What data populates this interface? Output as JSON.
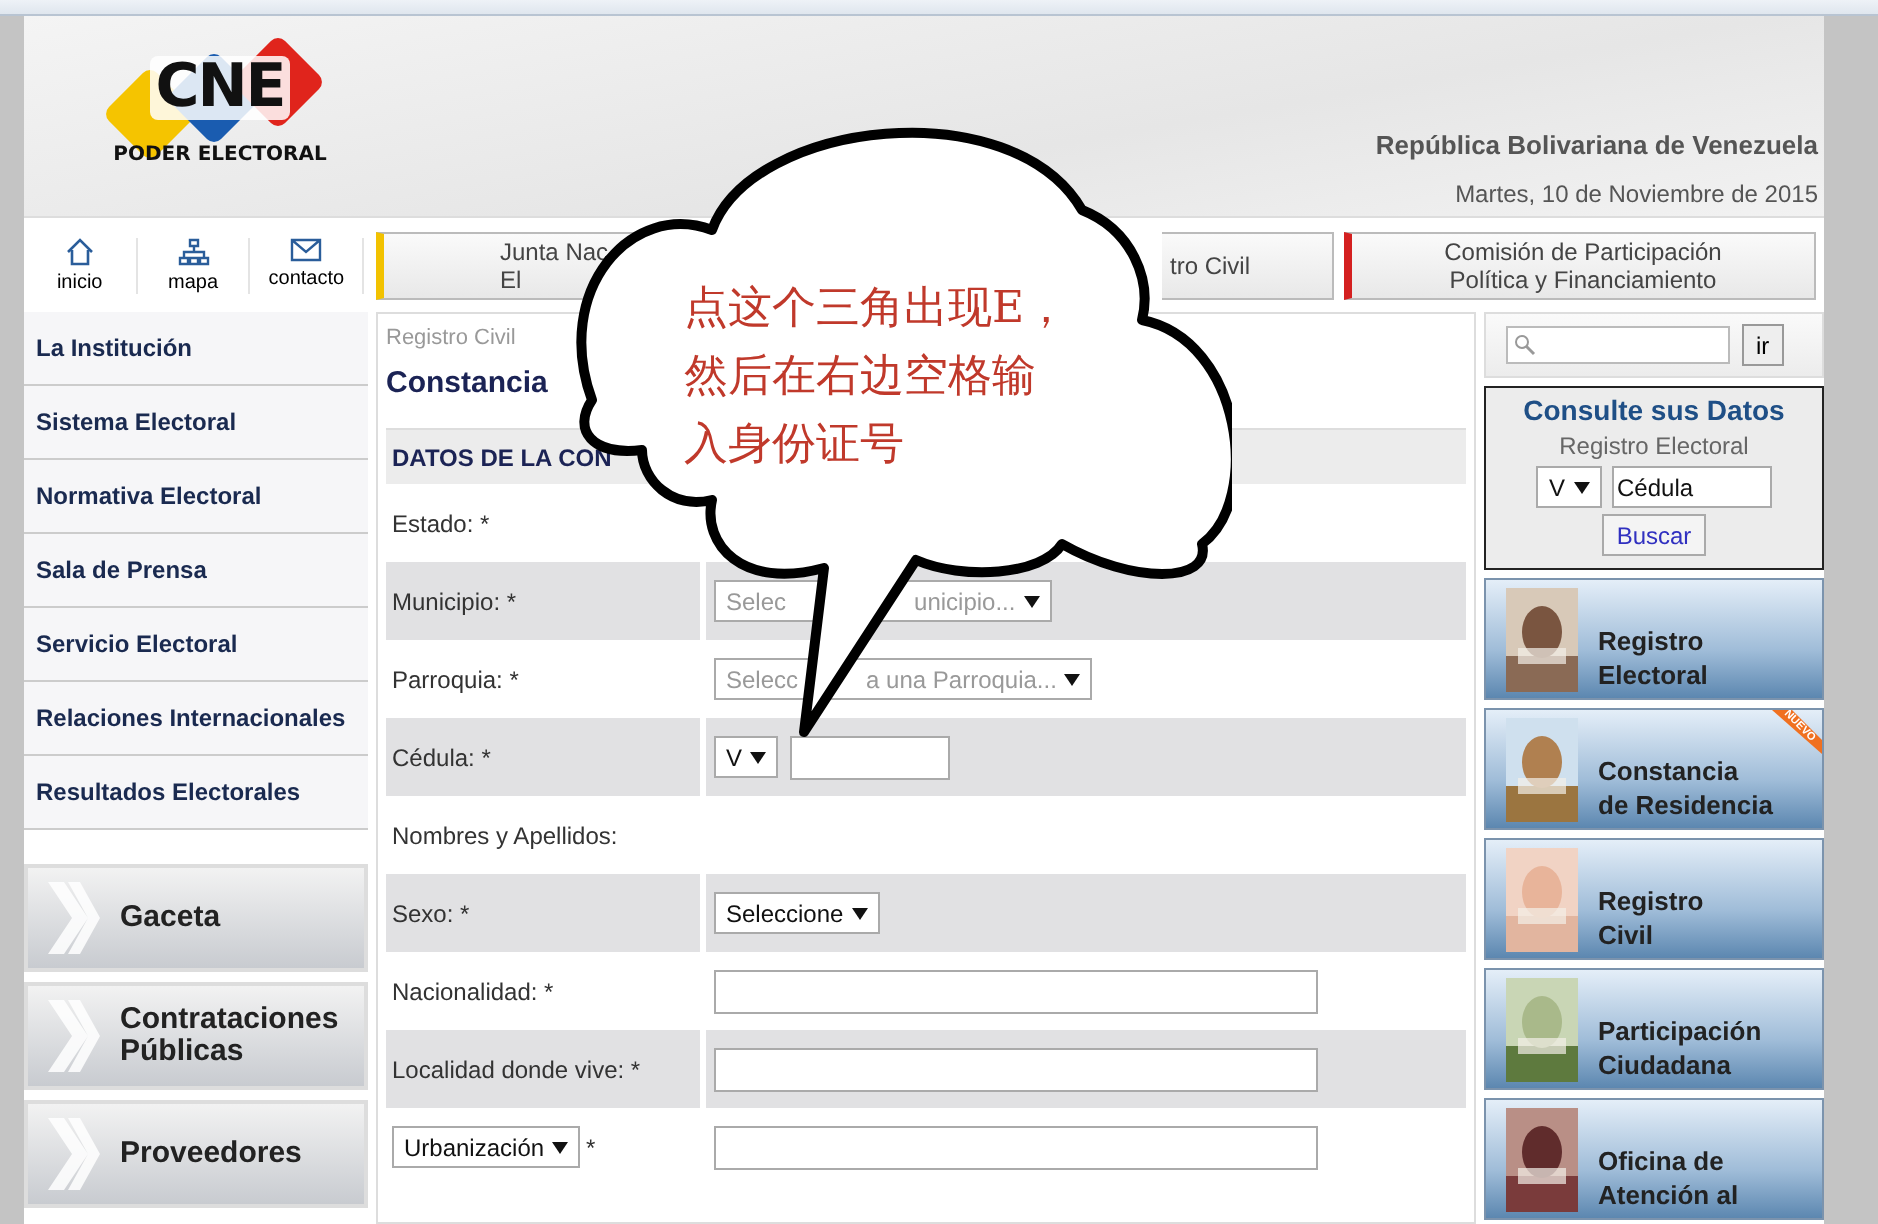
{
  "header": {
    "logo": "CNE",
    "logo_subtitle": "PODER ELECTORAL",
    "country": "República Bolivariana de Venezuela",
    "date": "Martes, 10 de Noviembre de 2015"
  },
  "quick_links": [
    {
      "kind": "home",
      "label": "inicio"
    },
    {
      "kind": "sitemap",
      "label": "mapa"
    },
    {
      "kind": "mail",
      "label": "contacto"
    }
  ],
  "top_tabs": [
    {
      "kind": "left",
      "lines": [
        "Junta Nac",
        "El"
      ],
      "color": "#f2c200"
    },
    {
      "kind": "middle",
      "lines": [
        "tro Civil"
      ]
    },
    {
      "kind": "full",
      "lines": [
        "Comisión de Participación",
        "Política y Financiamiento"
      ],
      "color": "#d42020"
    }
  ],
  "sidebar": {
    "items": [
      "La Institución",
      "Sistema Electoral",
      "Normativa Electoral",
      "Sala de Prensa",
      "Servicio Electoral",
      "Relaciones Internacionales",
      "Resultados Electorales"
    ],
    "banners": [
      {
        "lines": [
          "Gaceta"
        ]
      },
      {
        "lines": [
          "Contrataciones",
          "Públicas"
        ]
      },
      {
        "lines": [
          "Proveedores"
        ]
      }
    ]
  },
  "main": {
    "breadcrumb": "Registro Civil",
    "title": "Constancia",
    "section": "DATOS DE LA CON",
    "rows": [
      {
        "label": "Estado: *",
        "kind": "empty"
      },
      {
        "label": "Municipio: *",
        "kind": "select",
        "parts": [
          "Selec",
          "unicipio..."
        ],
        "disabled": true
      },
      {
        "label": "Parroquia: *",
        "kind": "select",
        "parts": [
          "Selecc",
          "a una Parroquia..."
        ],
        "disabled": true
      },
      {
        "label": "Cédula: *",
        "kind": "cedula",
        "prefix": "V"
      },
      {
        "label": "Nombres y Apellidos:",
        "kind": "empty"
      },
      {
        "label": "Sexo: *",
        "kind": "select",
        "parts": [
          "Seleccione"
        ],
        "disabled": false
      },
      {
        "label": "Nacionalidad: *",
        "kind": "text"
      },
      {
        "label": "Localidad donde vive: *",
        "kind": "text"
      },
      {
        "label": "*",
        "kind": "labelselect",
        "select": "Urbanización"
      }
    ]
  },
  "right": {
    "search_button": "ir",
    "consult": {
      "title": "Consulte sus Datos",
      "subtitle": "Registro Electoral",
      "prefix": "V",
      "placeholder": "Cédula",
      "button": "Buscar"
    },
    "cards": [
      {
        "lines": [
          "Registro",
          "Electoral"
        ]
      },
      {
        "lines": [
          "Constancia",
          "de Residencia"
        ],
        "badge": "NUEVO"
      },
      {
        "lines": [
          "Registro",
          "Civil"
        ]
      },
      {
        "lines": [
          "Participación",
          "Ciudadana"
        ]
      },
      {
        "lines": [
          "Oficina de",
          "Atención al"
        ]
      }
    ]
  },
  "callout": {
    "lines": [
      "点这个三角出现E，",
      "然后在右边空格输",
      "入身份证号"
    ]
  }
}
